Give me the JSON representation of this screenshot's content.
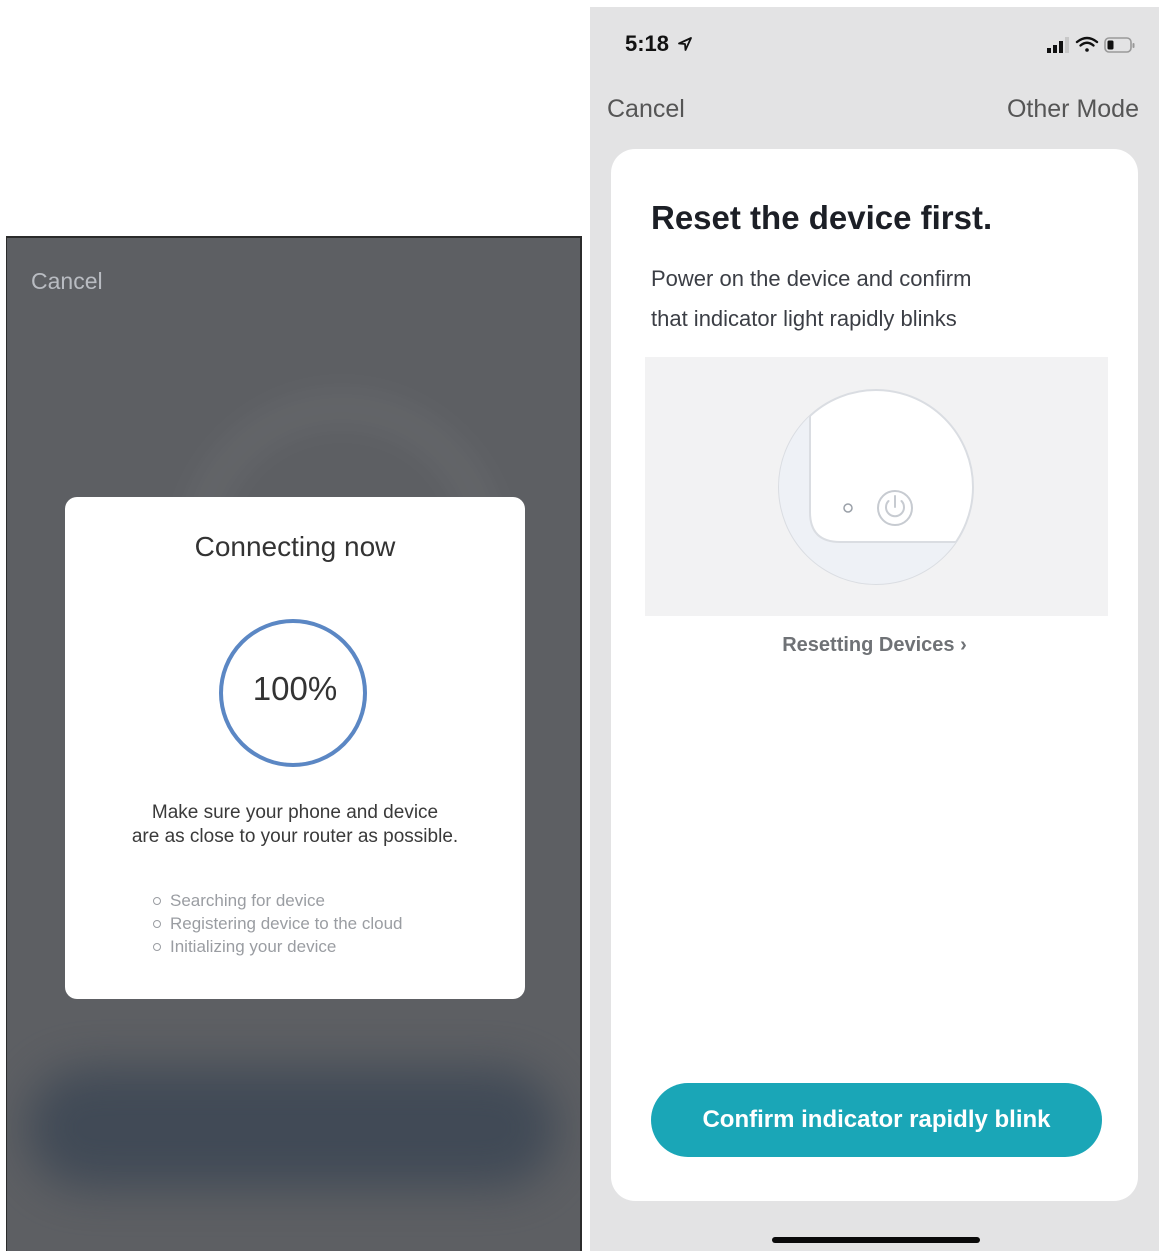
{
  "left": {
    "cancel": "Cancel",
    "modal_title": "Connecting now",
    "progress": {
      "value": 1.0,
      "label": "100%"
    },
    "message_line1": "Make sure your phone and device",
    "message_line2": "are as close to your router as possible.",
    "steps": [
      "Searching for device",
      "Registering device to the cloud",
      "Initializing your device"
    ],
    "ring_color": "#5b87c4"
  },
  "right": {
    "status": {
      "time": "5:18",
      "location_icon": "location-arrow-icon"
    },
    "nav": {
      "cancel": "Cancel",
      "other_mode": "Other Mode"
    },
    "title": "Reset the device first.",
    "desc_line1": "Power on the device and confirm",
    "desc_line2": "that indicator light rapidly blinks",
    "link": "Resetting Devices",
    "confirm_button": "Confirm indicator rapidly blink",
    "accent": "#1aa6b7"
  }
}
